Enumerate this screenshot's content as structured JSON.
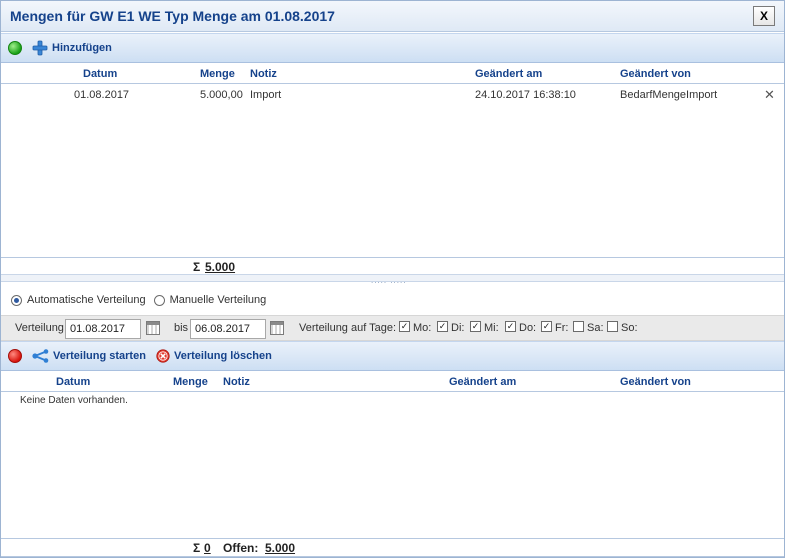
{
  "window": {
    "title": "Mengen für GW E1 WE Typ Menge am 01.08.2017",
    "close_label": "X"
  },
  "top_toolbar": {
    "add_label": "Hinzufügen"
  },
  "top_grid": {
    "columns": {
      "datum": "Datum",
      "menge": "Menge",
      "notiz": "Notiz",
      "geaendert_am": "Geändert am",
      "geaendert_von": "Geändert von"
    },
    "rows": [
      {
        "datum": "01.08.2017",
        "menge": "5.000,00",
        "notiz": "Import",
        "geaendert_am": "24.10.2017 16:38:10",
        "geaendert_von": "BedarfMengeImport",
        "delete": "✕"
      }
    ],
    "sum_symbol": "Σ",
    "sum_value": "5.000"
  },
  "splitter": {
    "grip": "..... ....."
  },
  "distribution": {
    "auto_label": "Automatische Verteilung",
    "manual_label": "Manuelle Verteilung",
    "selected": "auto",
    "verteilung_label": "Verteilung",
    "from_date": "01.08.2017",
    "bis_label": "bis",
    "to_date": "06.08.2017",
    "days_label": "Verteilung auf Tage:",
    "days": [
      {
        "label": "Mo:",
        "checked": true
      },
      {
        "label": "Di:",
        "checked": true
      },
      {
        "label": "Mi:",
        "checked": true
      },
      {
        "label": "Do:",
        "checked": true
      },
      {
        "label": "Fr:",
        "checked": true
      },
      {
        "label": "Sa:",
        "checked": false
      },
      {
        "label": "So:",
        "checked": false
      }
    ]
  },
  "bottom_toolbar": {
    "start_label": "Verteilung starten",
    "delete_label": "Verteilung löschen"
  },
  "bottom_grid": {
    "columns": {
      "datum": "Datum",
      "menge": "Menge",
      "notiz": "Notiz",
      "geaendert_am": "Geändert am",
      "geaendert_von": "Geändert von"
    },
    "empty_message": "Keine Daten vorhanden.",
    "sum_symbol": "Σ",
    "sum_value": "0",
    "offen_label": "Offen:",
    "offen_value": "5.000"
  },
  "colors": {
    "accent": "#15428b",
    "danger": "#d0140d"
  }
}
